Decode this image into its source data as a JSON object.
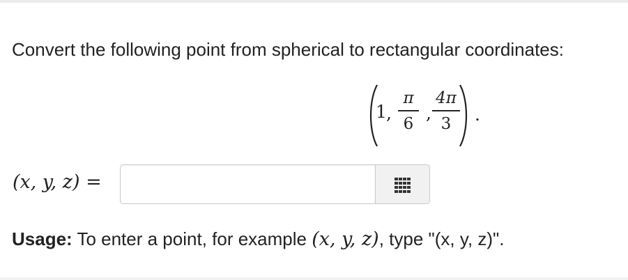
{
  "problem": {
    "prompt": "Convert the following point from spherical to rectangular coordinates:",
    "point": {
      "rho": "1",
      "theta_num": "π",
      "theta_den": "6",
      "phi_num": "4π",
      "phi_den": "3",
      "separator": ",",
      "terminator": "."
    }
  },
  "answer": {
    "label": "(x, y, z) =",
    "value": "",
    "placeholder": "",
    "keypad_icon": "keypad-grid-icon"
  },
  "usage": {
    "strong": "Usage:",
    "text_before": " To enter a point, for example ",
    "example_math": "(x, y, z)",
    "text_after": ", type \"(x, y, z)\"."
  }
}
